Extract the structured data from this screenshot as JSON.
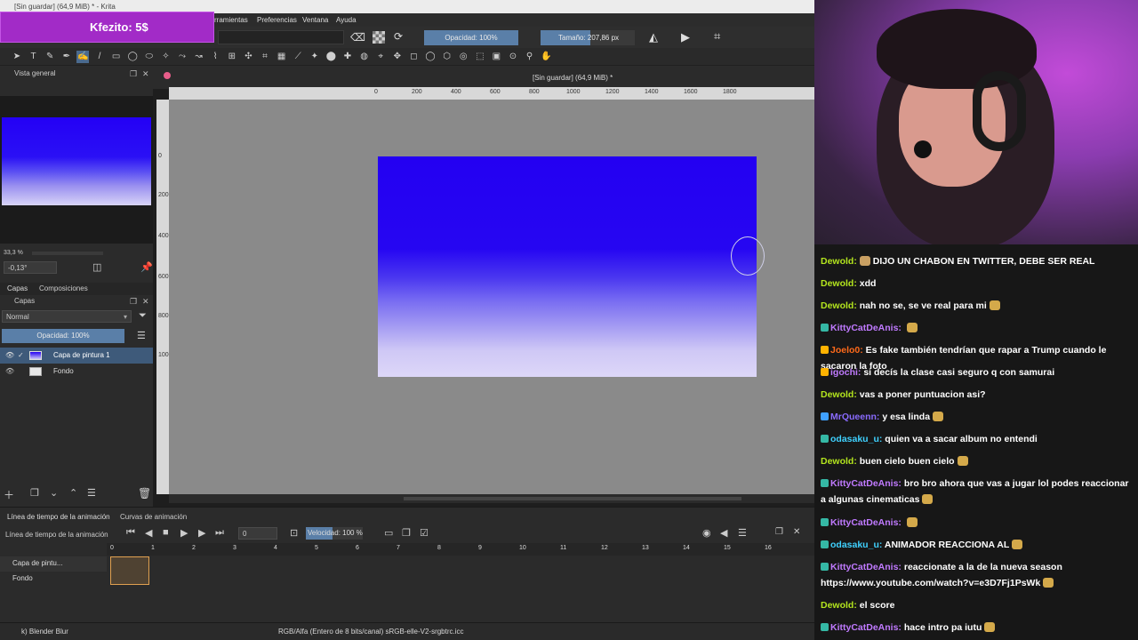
{
  "window": {
    "title": "[Sin guardar] (64,9 MiB) * - Krita"
  },
  "donation": {
    "text": "Kfezito: 5$"
  },
  "menu": [
    "rramientas",
    "Preferencias",
    "Ventana",
    "Ayuda"
  ],
  "tool_options": {
    "opacity": "Opacidad: 100%",
    "size": "Tamaño: 207,86 px"
  },
  "overview": {
    "title": "Vista general",
    "zoom": "33,3 %",
    "rotation": "-0,13°"
  },
  "layers_tabs": [
    "Capas",
    "Composiciones"
  ],
  "layers": {
    "title": "Capas",
    "blend_mode": "Normal",
    "opacity": "Opacidad: 100%",
    "items": [
      "Capa de pintura 1",
      "Fondo"
    ]
  },
  "canvas": {
    "tab_title": "[Sin guardar] (64,9 MiB) *",
    "ruler_h": [
      "0",
      "200",
      "400",
      "600",
      "800",
      "1000",
      "1200",
      "1400",
      "1600",
      "1800"
    ],
    "ruler_v": [
      "0",
      "200",
      "400",
      "600",
      "800",
      "1000"
    ]
  },
  "timeline": {
    "tabs": [
      "Línea de tiempo de la animación",
      "Curvas de animación"
    ],
    "title": "Línea de tiempo de la animación",
    "frame": "0",
    "speed": "Velocidad: 100 %",
    "frames": [
      "0",
      "1",
      "2",
      "3",
      "4",
      "5",
      "6",
      "7",
      "8",
      "9",
      "10",
      "11",
      "12",
      "13",
      "14",
      "15",
      "16"
    ],
    "layers": [
      "Capa de pintu...",
      "Fondo"
    ]
  },
  "status": {
    "brush": "k) Blender Blur",
    "color": "RGB/Alfa (Entero de 8 bits/canal)  sRGB-elle-V2-srgbtrc.icc"
  },
  "chat": [
    {
      "user": "Dewold",
      "color": "#b4e61e",
      "badge": "",
      "text": "DIJO UN CHABON EN TWITTER, DEBE SER REAL",
      "emote_before": true
    },
    {
      "user": "Dewold",
      "color": "#b4e61e",
      "badge": "",
      "text": "xdd"
    },
    {
      "user": "Dewold",
      "color": "#b4e61e",
      "badge": "",
      "text": "nah no se, se ve real para mi",
      "emote_after": true
    },
    {
      "user": "KittyCatDeAnis",
      "color": "#c07aff",
      "badge": "#35b8a5",
      "text": "",
      "emote_after": true
    },
    {
      "user": "Joelo0",
      "color": "#ff6a1a",
      "badge": "#ffb300",
      "text": "Es fake también tendrían que rapar a Trump cuando le sacaron la foto"
    },
    {
      "user": "igochi",
      "color": "#c07aff",
      "badge": "#ffb300",
      "text": "si decís la clase casi seguro q con samurai"
    },
    {
      "user": "Dewold",
      "color": "#b4e61e",
      "badge": "",
      "text": "vas a poner puntuacion asi?"
    },
    {
      "user": "MrQueenn",
      "color": "#8a6bff",
      "badge": "#3fa0ff",
      "text": "y esa linda",
      "emote_after": true
    },
    {
      "user": "odasaku_u",
      "color": "#3fd1ff",
      "badge": "#35b8a5",
      "text": "quien va a sacar album no entendi"
    },
    {
      "user": "Dewold",
      "color": "#b4e61e",
      "badge": "",
      "text": "buen cielo buen cielo",
      "emote_after": true
    },
    {
      "user": "KittyCatDeAnis",
      "color": "#c07aff",
      "badge": "#35b8a5",
      "text": "bro bro ahora que vas a jugar lol podes reaccionar a algunas cinematicas",
      "emote_after": true
    },
    {
      "user": "KittyCatDeAnis",
      "color": "#c07aff",
      "badge": "#35b8a5",
      "text": "",
      "emote_after": true
    },
    {
      "user": "odasaku_u",
      "color": "#3fd1ff",
      "badge": "#35b8a5",
      "text": "ANIMADOR REACCIONA AL",
      "emote_after": true
    },
    {
      "user": "KittyCatDeAnis",
      "color": "#c07aff",
      "badge": "#35b8a5",
      "text": "reaccionate a la de la nueva season https://www.youtube.com/watch?v=e3D7Fj1PsWk",
      "emote_after": true
    },
    {
      "user": "Dewold",
      "color": "#b4e61e",
      "badge": "",
      "text": "el score"
    },
    {
      "user": "KittyCatDeAnis",
      "color": "#c07aff",
      "badge": "#35b8a5",
      "text": "hace intro pa iutu",
      "emote_after": true
    }
  ]
}
